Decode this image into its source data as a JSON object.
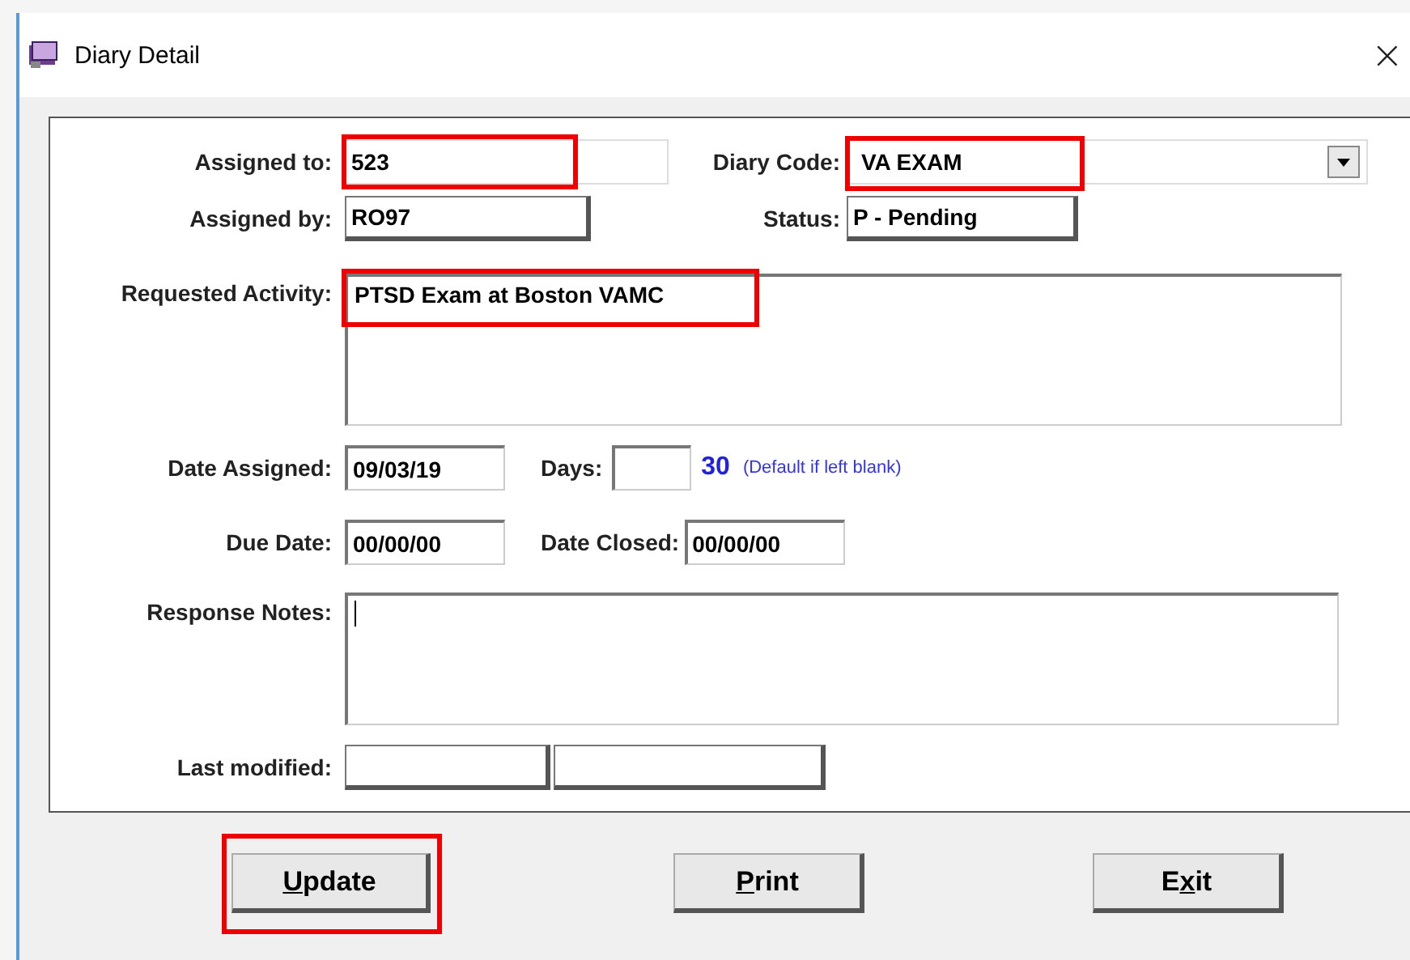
{
  "window": {
    "title": "Diary Detail",
    "close": "×"
  },
  "form": {
    "assigned_to": {
      "label": "Assigned to:",
      "value": "523",
      "highlighted": true
    },
    "diary_code": {
      "label": "Diary Code:",
      "value": "VA EXAM",
      "highlighted": true
    },
    "assigned_by": {
      "label": "Assigned by:",
      "value": "RO97"
    },
    "status": {
      "label": "Status:",
      "value": "P - Pending"
    },
    "requested_activity": {
      "label": "Requested Activity:",
      "value": "PTSD Exam at Boston VAMC",
      "highlighted": true
    },
    "date_assigned": {
      "label": "Date Assigned:",
      "value": "09/03/19"
    },
    "days": {
      "label": "Days:",
      "default_value": "30",
      "hint": "(Default if left blank)"
    },
    "due_date": {
      "label": "Due Date:",
      "value": "00/00/00"
    },
    "date_closed": {
      "label": "Date Closed:",
      "value": "00/00/00"
    },
    "response_notes": {
      "label": "Response Notes:"
    },
    "last_modified": {
      "label": "Last modified:"
    }
  },
  "buttons": [
    {
      "key": "U",
      "after": "pdate",
      "highlighted": true
    },
    {
      "key": "P",
      "after": "rint",
      "highlighted": false
    },
    {
      "before": "E",
      "key": "x",
      "after": "it",
      "highlighted": false
    }
  ]
}
